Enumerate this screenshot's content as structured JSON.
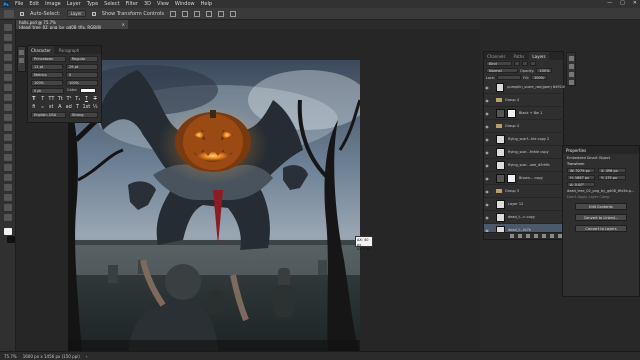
{
  "menubar": {
    "logo": "Ps",
    "items": [
      "File",
      "Edit",
      "Image",
      "Layer",
      "Type",
      "Select",
      "Filter",
      "3D",
      "View",
      "Window",
      "Help"
    ],
    "window_controls": [
      "—",
      "□",
      "✕"
    ]
  },
  "options_bar": {
    "auto_select_label": "Auto-Select:",
    "auto_select_value": "Layer",
    "show_transform_label": "Show Transform Controls"
  },
  "document_tab": {
    "title": "halls.psd @ 75.7% (dead_tree_02_png_by_gd08_tfix, RGB/8)",
    "close": "×"
  },
  "character_panel": {
    "tabs": [
      "Character",
      "Paragraph"
    ],
    "font_family": "Princetown",
    "font_style": "Regular",
    "font_size": "11 pt",
    "leading": "29 pt",
    "kerning": "Metrics",
    "tracking": "0",
    "vertical_scale": "100%",
    "horizontal_scale": "100%",
    "baseline": "0 pt",
    "color_label": "Color:",
    "style_glyphs": [
      "T",
      "T",
      "TT",
      "Tt",
      "T¹",
      "T₁",
      "T",
      "T"
    ],
    "opentype_glyphs": [
      "fi",
      "ℴ",
      "st",
      "A",
      "ad",
      "T",
      "1st",
      "½"
    ],
    "language": "English: USA",
    "antialias": "Strong"
  },
  "layers_panel": {
    "tabs": [
      "Channels",
      "Paths",
      "Layers"
    ],
    "filter_kind": "Kind",
    "blend_mode": "Normal",
    "opacity_label": "Opacity:",
    "opacity_value": "100%",
    "lock_label": "Lock:",
    "fill_label": "Fill:",
    "fill_value": "100%",
    "layers": [
      {
        "name": "pumpkin_scare_ran(gam) 6492496",
        "type": "layer",
        "thumb": "light"
      },
      {
        "name": "Group 4",
        "type": "group",
        "thumb": "none"
      },
      {
        "name": "Black + Bw 1",
        "type": "adjustment",
        "thumb": "dark"
      },
      {
        "name": "Group 4",
        "type": "group",
        "thumb": "none"
      },
      {
        "name": "flying_scarf...hle copy 2",
        "type": "layer",
        "thumb": "light"
      },
      {
        "name": "flying_scar...frthle copy",
        "type": "layer",
        "thumb": "light"
      },
      {
        "name": "flying_scar...uee_d5rhfb",
        "type": "layer",
        "thumb": "light"
      },
      {
        "name": "Brown... copy",
        "type": "adjustment",
        "thumb": "dark"
      },
      {
        "name": "Group 3",
        "type": "group",
        "thumb": "none"
      },
      {
        "name": "Layer 12",
        "type": "layer",
        "thumb": "light"
      },
      {
        "name": "dead_t...n copy",
        "type": "layer",
        "thumb": "light"
      },
      {
        "name": "dead_t...fe7k",
        "type": "layer",
        "thumb": "light",
        "selected": true
      }
    ]
  },
  "properties_panel": {
    "title": "Properties",
    "subtitle": "Embedded Smart Object",
    "transform_label": "Transform",
    "w_value": "W: 3279 px",
    "h_value": "H: 1667 px",
    "x_value": "X: 496 px",
    "y_value": "Y: 175 px",
    "angle": "∆: 0.00°",
    "file_name": "dead_tree_02_png_by_gd08_tfix5b.p...",
    "layer_comp": "Don't Apply Layer Comp",
    "buttons": [
      "Edit Contents",
      "Convert to Linked...",
      "Convert to Layers"
    ]
  },
  "info_tooltip": {
    "line1": "ΔX: 40 px",
    "line2": "ΔY: 8 px"
  },
  "status_bar": {
    "zoom": "75.7%",
    "doc_size": "1600 px x 1456 px (150 ppi)",
    "arrow": "›"
  },
  "colors": {
    "app_bg": "#262626",
    "panel_bg": "#2f2f2f",
    "selection_blue": "#4b5a6b",
    "accent": "#31a8ff"
  }
}
